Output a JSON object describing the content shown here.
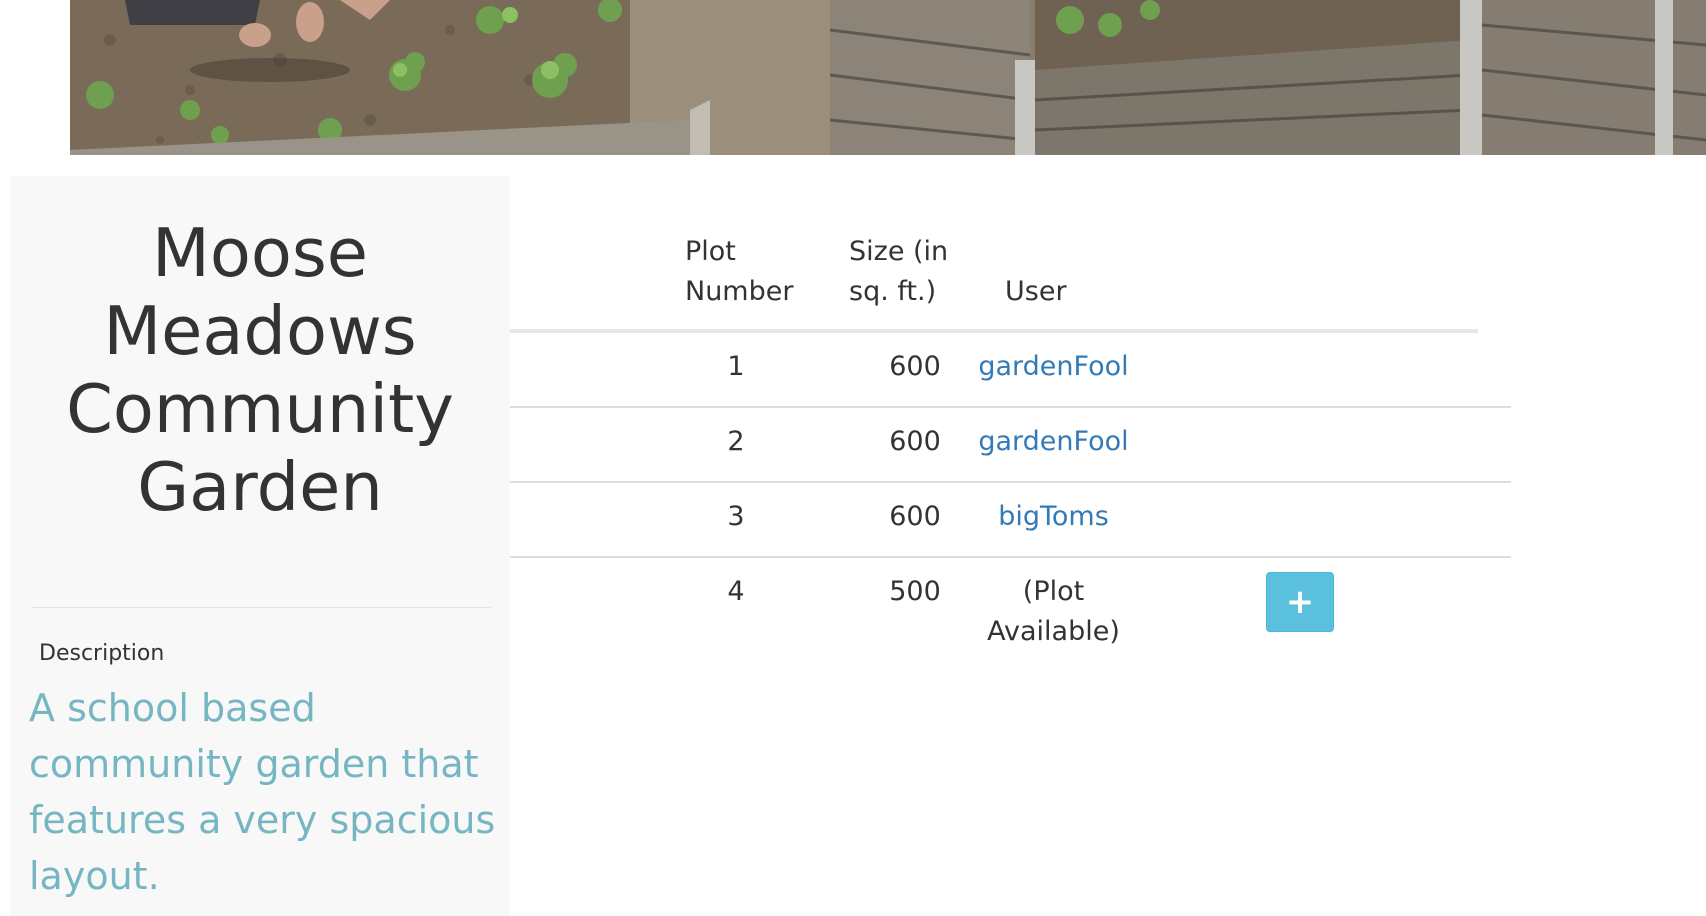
{
  "banner": {
    "image_alt": "Raised wooden garden beds with seedlings"
  },
  "garden": {
    "name": "Moose Meadows Community Garden",
    "description_label": "Description",
    "description": "A school based community garden that features a very spacious layout."
  },
  "plots_table": {
    "headers": {
      "plot_number": "Plot Number",
      "size": "Size (in sq. ft.)",
      "user": "User"
    },
    "rows": [
      {
        "plot_number": "1",
        "size": "600",
        "user": "gardenFool",
        "available": false
      },
      {
        "plot_number": "2",
        "size": "600",
        "user": "gardenFool",
        "available": false
      },
      {
        "plot_number": "3",
        "size": "600",
        "user": "bigToms",
        "available": false
      },
      {
        "plot_number": "4",
        "size": "500",
        "user": "(Plot Available)",
        "available": true
      }
    ],
    "add_button_icon": "plus-icon",
    "add_button_label": "+"
  },
  "colors": {
    "link": "#337ab7",
    "description_text": "#76b6c2",
    "info_button": "#5bc0de",
    "panel_background": "#f8f8f8"
  }
}
